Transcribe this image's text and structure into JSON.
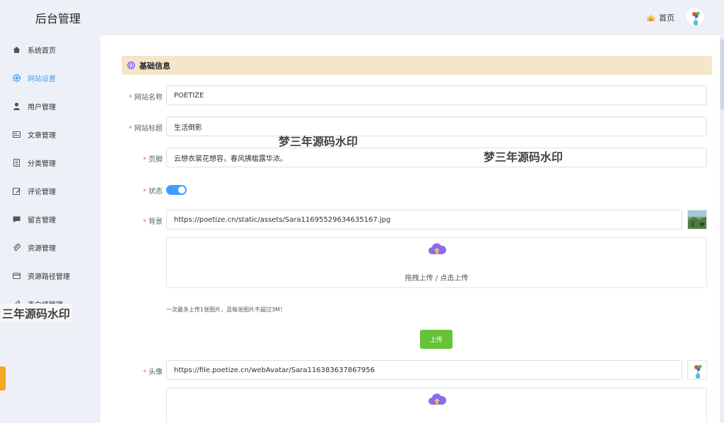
{
  "header": {
    "logo": "后台管理",
    "home_label": "首页"
  },
  "sidebar": {
    "items": [
      {
        "label": "系统首页",
        "icon": "home-icon"
      },
      {
        "label": "网站设置",
        "icon": "gear-icon",
        "active": true
      },
      {
        "label": "用户管理",
        "icon": "user-icon"
      },
      {
        "label": "文章管理",
        "icon": "article-icon"
      },
      {
        "label": "分类管理",
        "icon": "category-icon"
      },
      {
        "label": "评论管理",
        "icon": "edit-icon"
      },
      {
        "label": "留言管理",
        "icon": "message-icon"
      },
      {
        "label": "资源管理",
        "icon": "paperclip-icon"
      },
      {
        "label": "资源路径管理",
        "icon": "card-icon"
      },
      {
        "label": "表白墙管理",
        "icon": "pen-icon"
      }
    ]
  },
  "section": {
    "title": "基础信息"
  },
  "form": {
    "site_name": {
      "label": "网站名称",
      "value": "POETIZE"
    },
    "site_title": {
      "label": "网站标题",
      "value": "生活倒影"
    },
    "footer": {
      "label": "页脚",
      "value": "云想衣裳花想容，春风拂槛露华浓。"
    },
    "status": {
      "label": "状态",
      "on": true
    },
    "background": {
      "label": "背景",
      "value": "https://poetize.cn/static/assets/Sara11695529634635167.jpg"
    },
    "upload_text": "拖拽上传 / 点击上传",
    "upload_tip": "一次最多上传1张图片，且每张图片不超过3M！",
    "upload_button": "上传",
    "avatar": {
      "label": "头像",
      "value": "https://file.poetize.cn/webAvatar/Sara116383637867956"
    }
  },
  "watermark": "梦三年源码水印",
  "watermark_partial": "三年源码水印",
  "colors": {
    "accent": "#409eff",
    "section_bg": "#f5e6c9",
    "upload_green": "#67c23a",
    "cloud_purple": "#8a6cf0"
  }
}
